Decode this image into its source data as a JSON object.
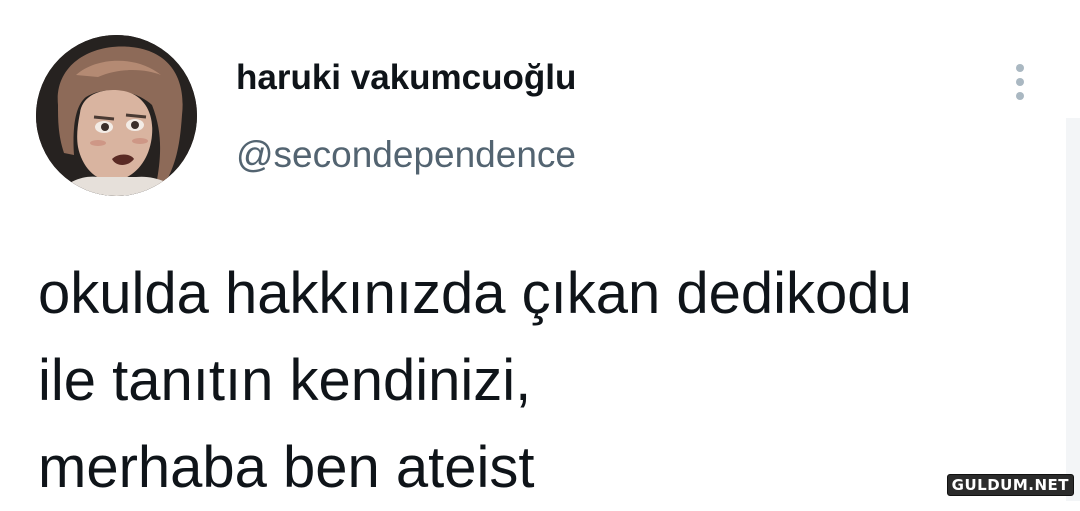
{
  "tweet": {
    "author": {
      "display_name": "haruki vakumcuoğlu",
      "handle": "@secondependence"
    },
    "text_lines": [
      "okulda hakkınızda çıkan dedikodu",
      "ile tanıtın kendinizi,",
      "merhaba ben ateist"
    ],
    "menu_icon": "more-vertical-icon"
  },
  "watermark": {
    "text": "GULDUM.NET"
  },
  "colors": {
    "text_primary": "#0f1419",
    "text_secondary": "#536471",
    "menu_dots": "#aab8c2",
    "background": "#ffffff"
  }
}
